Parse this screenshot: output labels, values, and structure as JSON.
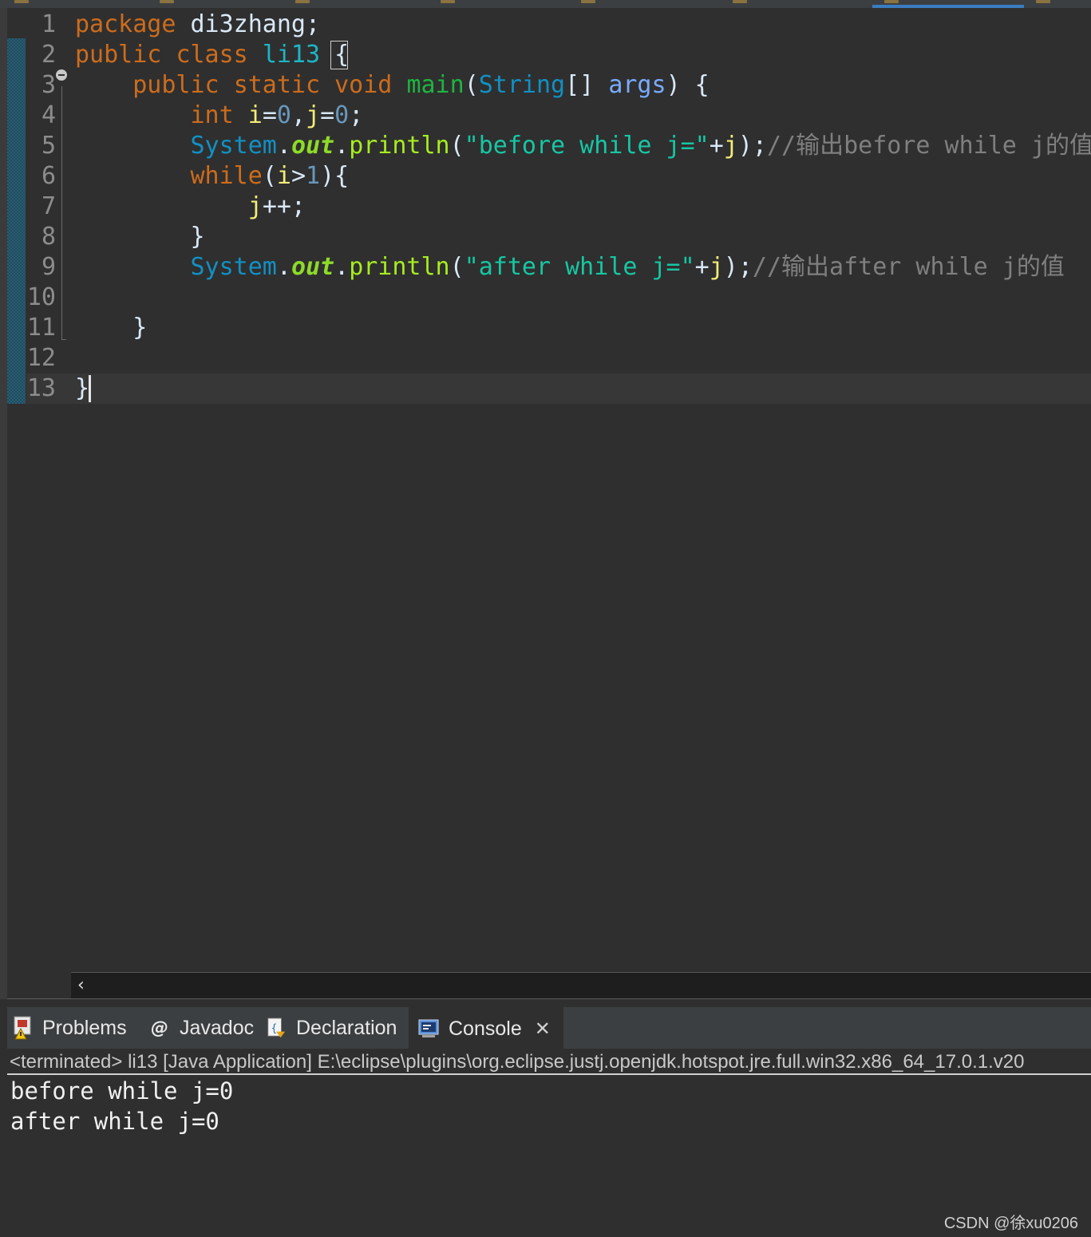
{
  "editor": {
    "lines": [
      {
        "num": "1",
        "tokens": [
          {
            "t": "package",
            "c": "kw"
          },
          {
            "t": " di3zhang;",
            "c": ""
          }
        ]
      },
      {
        "num": "2",
        "tokens": [
          {
            "t": "public",
            "c": "kw"
          },
          {
            "t": " ",
            "c": ""
          },
          {
            "t": "class",
            "c": "kw"
          },
          {
            "t": " ",
            "c": ""
          },
          {
            "t": "li13",
            "c": "cls"
          },
          {
            "t": " {",
            "c": ""
          }
        ]
      },
      {
        "num": "3",
        "tokens": [
          {
            "t": "    ",
            "c": ""
          },
          {
            "t": "public",
            "c": "kw"
          },
          {
            "t": " ",
            "c": ""
          },
          {
            "t": "static",
            "c": "kw"
          },
          {
            "t": " ",
            "c": ""
          },
          {
            "t": "void",
            "c": "kw"
          },
          {
            "t": " ",
            "c": ""
          },
          {
            "t": "main",
            "c": "meth"
          },
          {
            "t": "(",
            "c": ""
          },
          {
            "t": "String",
            "c": "type"
          },
          {
            "t": "[] ",
            "c": ""
          },
          {
            "t": "args",
            "c": "param"
          },
          {
            "t": ") {",
            "c": ""
          }
        ]
      },
      {
        "num": "4",
        "tokens": [
          {
            "t": "        ",
            "c": ""
          },
          {
            "t": "int",
            "c": "kw"
          },
          {
            "t": " ",
            "c": ""
          },
          {
            "t": "i",
            "c": "var"
          },
          {
            "t": "=",
            "c": ""
          },
          {
            "t": "0",
            "c": "num"
          },
          {
            "t": ",",
            "c": ""
          },
          {
            "t": "j",
            "c": "var"
          },
          {
            "t": "=",
            "c": ""
          },
          {
            "t": "0",
            "c": "num"
          },
          {
            "t": ";",
            "c": ""
          }
        ]
      },
      {
        "num": "5",
        "tokens": [
          {
            "t": "        ",
            "c": ""
          },
          {
            "t": "System",
            "c": "type"
          },
          {
            "t": ".",
            "c": ""
          },
          {
            "t": "out",
            "c": "static-field"
          },
          {
            "t": ".",
            "c": ""
          },
          {
            "t": "println",
            "c": "fn"
          },
          {
            "t": "(",
            "c": ""
          },
          {
            "t": "\"before while j=\"",
            "c": "str"
          },
          {
            "t": "+",
            "c": ""
          },
          {
            "t": "j",
            "c": "var"
          },
          {
            "t": ");",
            "c": ""
          },
          {
            "t": "//输出before while j的值",
            "c": "cmt"
          }
        ]
      },
      {
        "num": "6",
        "tokens": [
          {
            "t": "        ",
            "c": ""
          },
          {
            "t": "while",
            "c": "kw"
          },
          {
            "t": "(",
            "c": ""
          },
          {
            "t": "i",
            "c": "var"
          },
          {
            "t": ">",
            "c": ""
          },
          {
            "t": "1",
            "c": "num"
          },
          {
            "t": "){",
            "c": ""
          }
        ]
      },
      {
        "num": "7",
        "tokens": [
          {
            "t": "            ",
            "c": ""
          },
          {
            "t": "j",
            "c": "var"
          },
          {
            "t": "++;",
            "c": ""
          }
        ]
      },
      {
        "num": "8",
        "tokens": [
          {
            "t": "        }",
            "c": ""
          }
        ]
      },
      {
        "num": "9",
        "tokens": [
          {
            "t": "        ",
            "c": ""
          },
          {
            "t": "System",
            "c": "type"
          },
          {
            "t": ".",
            "c": ""
          },
          {
            "t": "out",
            "c": "static-field"
          },
          {
            "t": ".",
            "c": ""
          },
          {
            "t": "println",
            "c": "fn"
          },
          {
            "t": "(",
            "c": ""
          },
          {
            "t": "\"after while j=\"",
            "c": "str"
          },
          {
            "t": "+",
            "c": ""
          },
          {
            "t": "j",
            "c": "var"
          },
          {
            "t": ");",
            "c": ""
          },
          {
            "t": "//输出after while j的值",
            "c": "cmt"
          }
        ]
      },
      {
        "num": "10",
        "tokens": []
      },
      {
        "num": "11",
        "tokens": [
          {
            "t": "    }",
            "c": ""
          }
        ]
      },
      {
        "num": "12",
        "tokens": []
      },
      {
        "num": "13",
        "tokens": [
          {
            "t": "}",
            "c": ""
          }
        ]
      }
    ]
  },
  "scrollbar": {
    "left_arrow": "‹"
  },
  "panel": {
    "tabs": {
      "problems": "Problems",
      "javadoc": "Javadoc",
      "declaration": "Declaration",
      "console": "Console"
    },
    "console_close": "✕",
    "status": "<terminated> li13 [Java Application] E:\\eclipse\\plugins\\org.eclipse.justj.openjdk.hotspot.jre.full.win32.x86_64_17.0.1.v20",
    "output": [
      "before while j=0",
      "after while j=0"
    ]
  },
  "watermark": "CSDN @徐xu0206",
  "icons": {
    "problems": "problems-icon",
    "javadoc": "at-icon",
    "declaration": "declaration-icon",
    "console": "console-icon",
    "fold": "collapse-icon"
  }
}
